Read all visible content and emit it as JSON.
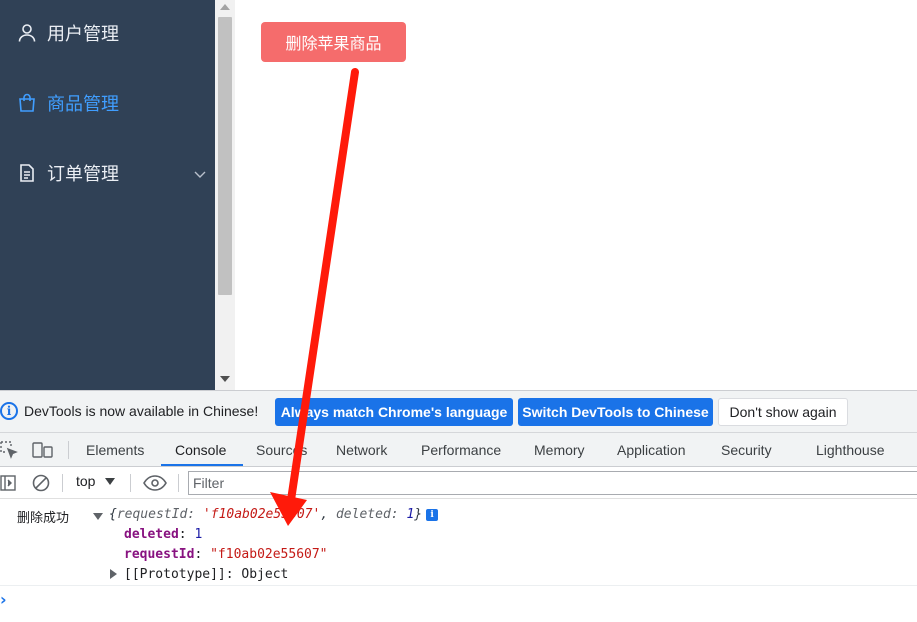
{
  "sidebar": {
    "items": [
      {
        "label": "用户管理",
        "icon": "user-icon"
      },
      {
        "label": "商品管理",
        "icon": "shopping-bag-icon",
        "active": true
      },
      {
        "label": "订单管理",
        "icon": "document-icon",
        "expandable": true
      }
    ],
    "background": "#304156",
    "active_color": "#409eff"
  },
  "main": {
    "delete_button_label": "删除苹果商品",
    "delete_button_color": "#f56c6c"
  },
  "devtools": {
    "infobar": {
      "message": "DevTools is now available in Chinese!",
      "buttons": [
        "Always match Chrome's language",
        "Switch DevTools to Chinese",
        "Don't show again"
      ]
    },
    "tabs": [
      "Elements",
      "Console",
      "Sources",
      "Network",
      "Performance",
      "Memory",
      "Application",
      "Security",
      "Lighthouse"
    ],
    "active_tab": "Console",
    "toolbar": {
      "context": "top",
      "filter_placeholder": "Filter"
    },
    "console": {
      "log_label": "删除成功",
      "summary": {
        "open": "{",
        "request_key": "requestId: ",
        "request_val": "'f10ab02e55607'",
        "sep": ", ",
        "deleted_key": "deleted: ",
        "deleted_val": "1",
        "close": "}"
      },
      "props": [
        {
          "key": "deleted",
          "sep": ": ",
          "value": "1"
        },
        {
          "key": "requestId",
          "sep": ": ",
          "value": "\"f10ab02e55607\""
        },
        {
          "key": "[[Prototype]]",
          "sep": ": ",
          "value": "Object"
        }
      ],
      "prompt": "›"
    }
  },
  "annotation": {
    "arrow_color": "#ff1a0a"
  }
}
